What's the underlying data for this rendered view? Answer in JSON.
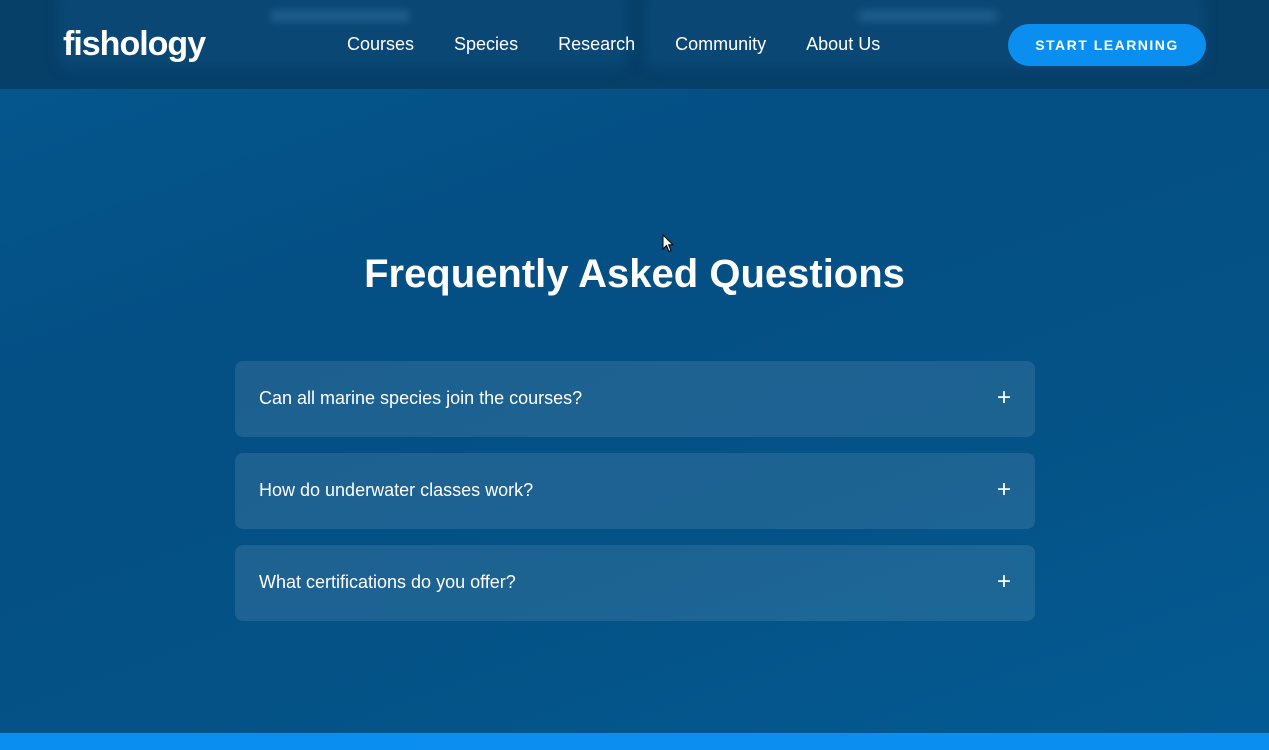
{
  "header": {
    "logo": "fishology",
    "nav": [
      {
        "label": "Courses"
      },
      {
        "label": "Species"
      },
      {
        "label": "Research"
      },
      {
        "label": "Community"
      },
      {
        "label": "About Us"
      }
    ],
    "cta_label": "START LEARNING"
  },
  "faq": {
    "title": "Frequently Asked Questions",
    "items": [
      {
        "question": "Can all marine species join the courses?",
        "toggle": "+"
      },
      {
        "question": "How do underwater classes work?",
        "toggle": "+"
      },
      {
        "question": "What certifications do you offer?",
        "toggle": "+"
      }
    ]
  },
  "colors": {
    "background": "#04528a",
    "header": "#063f68",
    "accent": "#0a8ff0",
    "text": "#ffffff"
  }
}
